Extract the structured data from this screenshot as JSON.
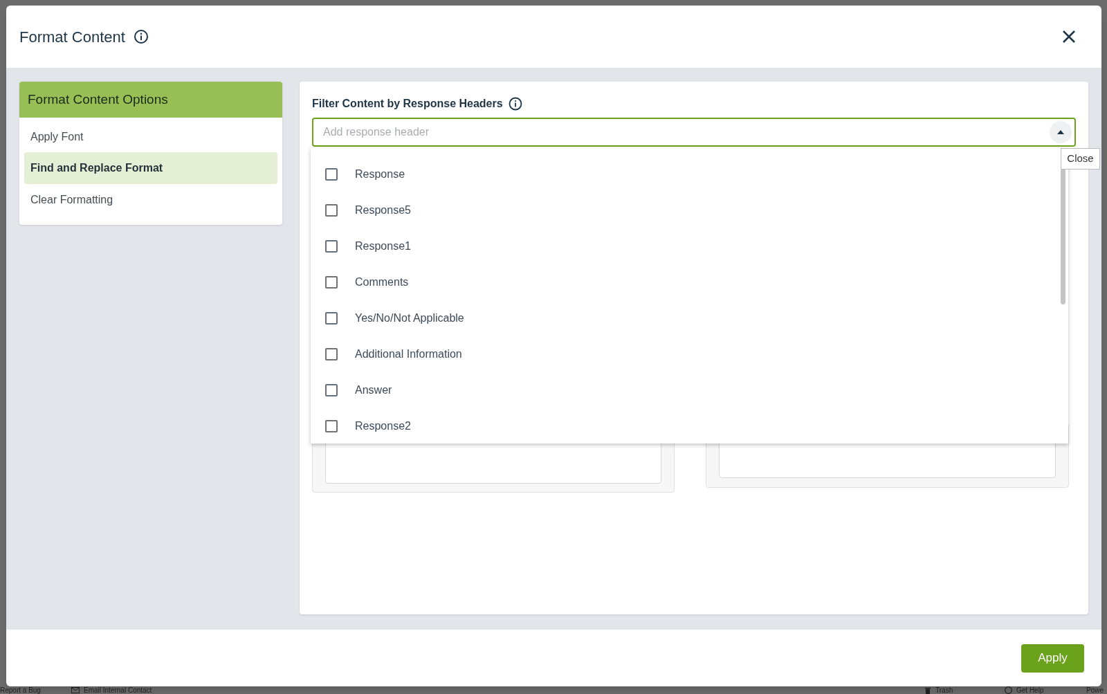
{
  "background_footer": {
    "links": [
      {
        "label": "Report a Bug"
      },
      {
        "label": "Email Internal Contact"
      },
      {
        "label": "Trash"
      },
      {
        "label": "Get Help"
      },
      {
        "label": "Powe"
      }
    ]
  },
  "dialog": {
    "title": "Format Content",
    "sidebar": {
      "title": "Format Content Options",
      "items": [
        {
          "label": "Apply Font",
          "selected": false
        },
        {
          "label": "Find and Replace Format",
          "selected": true
        },
        {
          "label": "Clear Formatting",
          "selected": false
        }
      ]
    },
    "filter": {
      "label": "Filter Content by Response Headers",
      "placeholder": "Add response header",
      "expanded": true,
      "options": [
        {
          "label": "Response",
          "checked": false
        },
        {
          "label": "Response5",
          "checked": false
        },
        {
          "label": "Response1",
          "checked": false
        },
        {
          "label": "Comments",
          "checked": false
        },
        {
          "label": "Yes/No/Not Applicable",
          "checked": false
        },
        {
          "label": "Additional Information",
          "checked": false
        },
        {
          "label": "Answer",
          "checked": false
        },
        {
          "label": "Response2",
          "checked": false
        }
      ]
    },
    "tooltip": "Close",
    "apply_button": "Apply"
  }
}
